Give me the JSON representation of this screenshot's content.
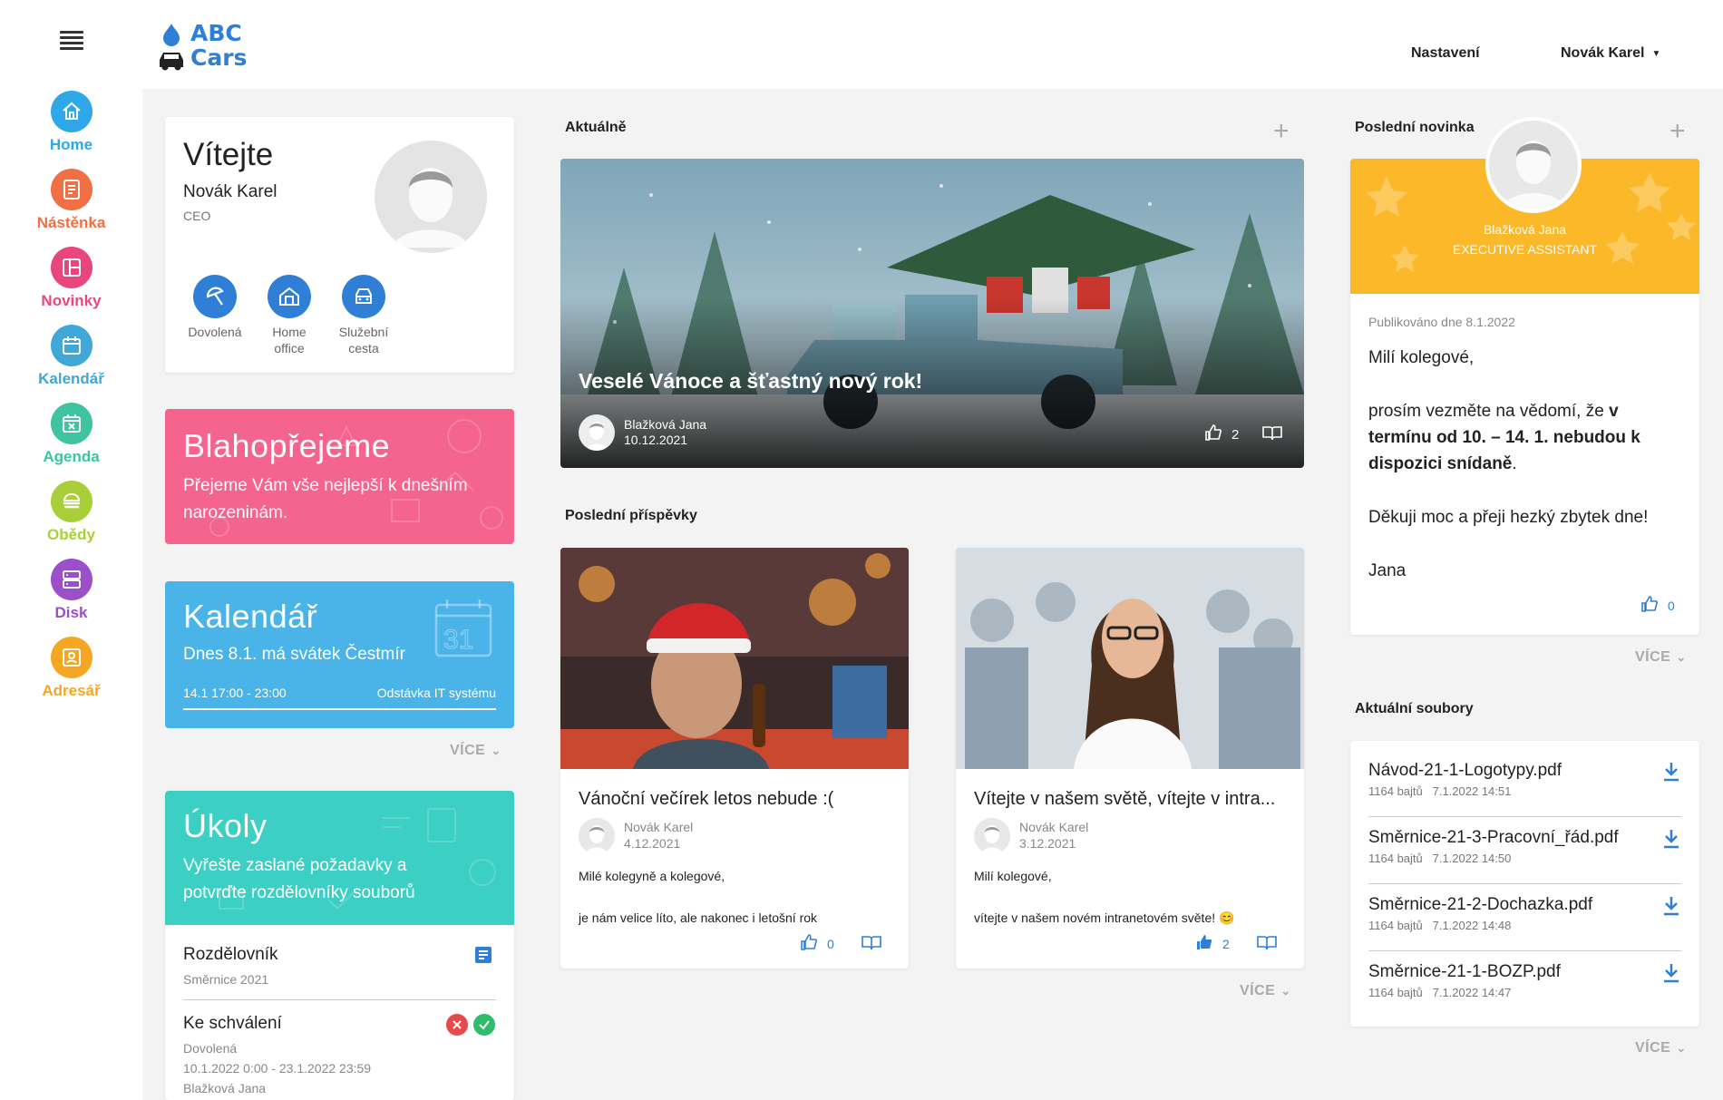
{
  "sidebar": {
    "items": [
      {
        "label": "Home",
        "color": "#2fa8e9",
        "icon": "home-icon"
      },
      {
        "label": "Nástěnka",
        "color": "#f07043",
        "icon": "board-icon"
      },
      {
        "label": "Novinky",
        "color": "#e8467c",
        "icon": "news-icon"
      },
      {
        "label": "Kalendář",
        "color": "#3fa8d6",
        "icon": "calendar-icon"
      },
      {
        "label": "Agenda",
        "color": "#3fc3a0",
        "icon": "agenda-icon"
      },
      {
        "label": "Obědy",
        "color": "#a9cf38",
        "icon": "lunch-icon"
      },
      {
        "label": "Disk",
        "color": "#9b4fc9",
        "icon": "disk-icon"
      },
      {
        "label": "Adresář",
        "color": "#f5a623",
        "icon": "contacts-icon"
      }
    ]
  },
  "header": {
    "logo_line1": "ABC",
    "logo_line2": "Cars",
    "settings": "Nastavení",
    "user": "Novák Karel"
  },
  "welcome": {
    "title": "Vítejte",
    "name": "Novák Karel",
    "role": "CEO",
    "actions": [
      {
        "label": "Dovolená",
        "icon": "vacation-icon"
      },
      {
        "label": "Home office",
        "icon": "home-office-icon"
      },
      {
        "label": "Služební cesta",
        "icon": "car-icon"
      }
    ]
  },
  "birthday": {
    "title": "Blahopřejeme",
    "text": "Přejeme Vám vše nejlepší k dnešním narozeninám.",
    "color": "#f5638f"
  },
  "calendar": {
    "title": "Kalendář",
    "text": "Dnes 8.1. má svátek Čestmír",
    "event_time": "14.1 17:00 - 23:00",
    "event_name": "Odstávka IT systému",
    "color": "#4ab3e8",
    "more": "VÍCE"
  },
  "tasks": {
    "title": "Úkoly",
    "text": "Vyřešte zaslané požadavky a potvrďte rozdělovníky souborů",
    "color": "#3ccfc4",
    "items": [
      {
        "title": "Rozdělovník",
        "sub": "Směrnice 2021"
      },
      {
        "title": "Ke schválení",
        "sub": "Dovolená",
        "dates": "10.1.2022 0:00 - 23.1.2022 23:59",
        "person": "Blažková Jana"
      }
    ]
  },
  "current": {
    "section": "Aktuálně",
    "title": "Veselé Vánoce a šťastný nový rok!",
    "author": "Blažková Jana",
    "date": "10.12.2021",
    "likes": "2"
  },
  "posts": {
    "section": "Poslední příspěvky",
    "more": "VÍCE",
    "items": [
      {
        "title": "Vánoční večírek letos nebude :(",
        "author": "Novák Karel",
        "date": "4.12.2021",
        "line1": "Milé kolegyně a kolegové,",
        "line2": "je nám velice líto, ale nakonec i letošní rok",
        "likes": "0"
      },
      {
        "title": "Vítejte v našem světě, vítejte v intra...",
        "author": "Novák Karel",
        "date": "3.12.2021",
        "line1": "Milí kolegové,",
        "line2": "vítejte v našem novém intranetovém světe! 😊",
        "likes": "2"
      }
    ]
  },
  "latest": {
    "section": "Poslední novinka",
    "person": "Blažková Jana",
    "position": "EXECUTIVE ASSISTANT",
    "color": "#fbb829",
    "published": "Publikováno dne 8.1.2022",
    "greeting": "Milí kolegové,",
    "body_start": "prosím vezměte na vědomí, že ",
    "body_bold": "v termínu od 10. – 14. 1. nebudou k dispozici snídaně",
    "body_end": ".",
    "thanks": "Děkuji moc a přeji hezký zbytek dne!",
    "sign": "Jana",
    "likes": "0",
    "more": "VÍCE"
  },
  "files": {
    "section": "Aktuální soubory",
    "more": "VÍCE",
    "items": [
      {
        "name": "Návod-21-1-Logotypy.pdf",
        "size": "1164 bajtů",
        "date": "7.1.2022 14:51"
      },
      {
        "name": "Směrnice-21-3-Pracovní_řád.pdf",
        "size": "1164 bajtů",
        "date": "7.1.2022 14:50"
      },
      {
        "name": "Směrnice-21-2-Dochazka.pdf",
        "size": "1164 bajtů",
        "date": "7.1.2022 14:48"
      },
      {
        "name": "Směrnice-21-1-BOZP.pdf",
        "size": "1164 bajtů",
        "date": "7.1.2022 14:47"
      }
    ]
  }
}
